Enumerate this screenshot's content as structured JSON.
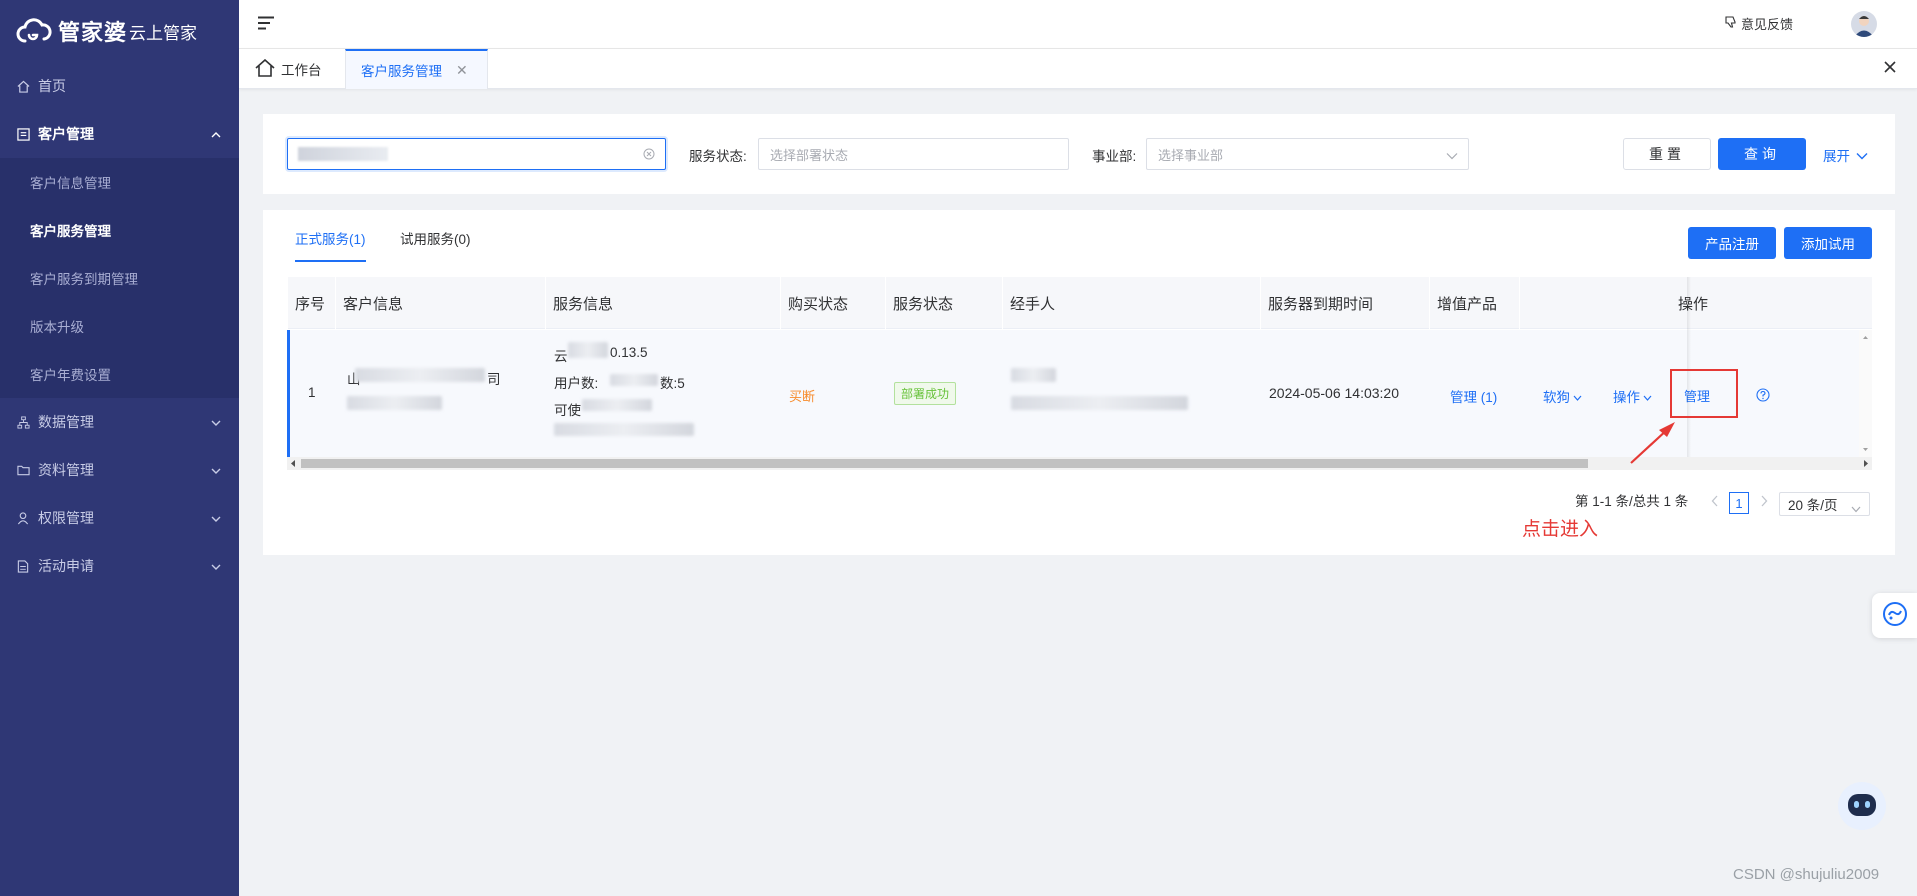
{
  "brand": {
    "name": "管家婆",
    "sub": "云上管家"
  },
  "sidebar": {
    "items": [
      {
        "label": "首页",
        "icon": "home-icon"
      },
      {
        "label": "客户管理",
        "icon": "list-icon",
        "open": true,
        "children": [
          {
            "label": "客户信息管理"
          },
          {
            "label": "客户服务管理",
            "active": true
          },
          {
            "label": "客户服务到期管理"
          },
          {
            "label": "版本升级"
          },
          {
            "label": "客户年费设置"
          }
        ]
      },
      {
        "label": "数据管理",
        "icon": "org-chart-icon"
      },
      {
        "label": "资料管理",
        "icon": "folder-icon"
      },
      {
        "label": "权限管理",
        "icon": "user-icon"
      },
      {
        "label": "活动申请",
        "icon": "document-icon"
      }
    ]
  },
  "header": {
    "feedback": "意见反馈"
  },
  "tabs": {
    "home": "工作台",
    "current": "客户服务管理"
  },
  "filters": {
    "service_status_label": "服务状态:",
    "service_status_placeholder": "选择部署状态",
    "division_label": "事业部:",
    "division_placeholder": "选择事业部",
    "reset": "重置",
    "query": "查询",
    "expand": "展开"
  },
  "table_section": {
    "tabs": [
      "正式服务(1)",
      "试用服务(0)"
    ],
    "btn_register": "产品注册",
    "btn_add_trial": "添加试用",
    "columns": [
      "序号",
      "客户信息",
      "服务信息",
      "购买状态",
      "服务状态",
      "经手人",
      "服务器到期时间",
      "增值产品",
      "操作"
    ],
    "rows": [
      {
        "index": "1",
        "customer_line1": "山",
        "customer_line1_end": "司",
        "service_line1_a": "云",
        "service_line1_b": "0.13.5",
        "service_line2_a": "用户数:",
        "service_line2_b": "数:5",
        "service_line3": "可使",
        "purchase_status": "买断",
        "service_status": "部署成功",
        "expire_time": "2024-05-06 14:03:20",
        "addon": "管理 (1)",
        "op_buy": "软狗",
        "op_action": "操作",
        "op_manage": "管理"
      }
    ]
  },
  "pagination": {
    "summary": "第 1-1 条/总共 1 条",
    "current": "1",
    "page_size": "20 条/页"
  },
  "annotation": {
    "text": "点击进入"
  },
  "watermark": "CSDN @shujuliu2009",
  "colors": {
    "primary": "#1e6ff5",
    "sidebar": "#2f3775",
    "annotation": "#e53935",
    "success": "#67c23a",
    "warning": "#f78c2d"
  }
}
